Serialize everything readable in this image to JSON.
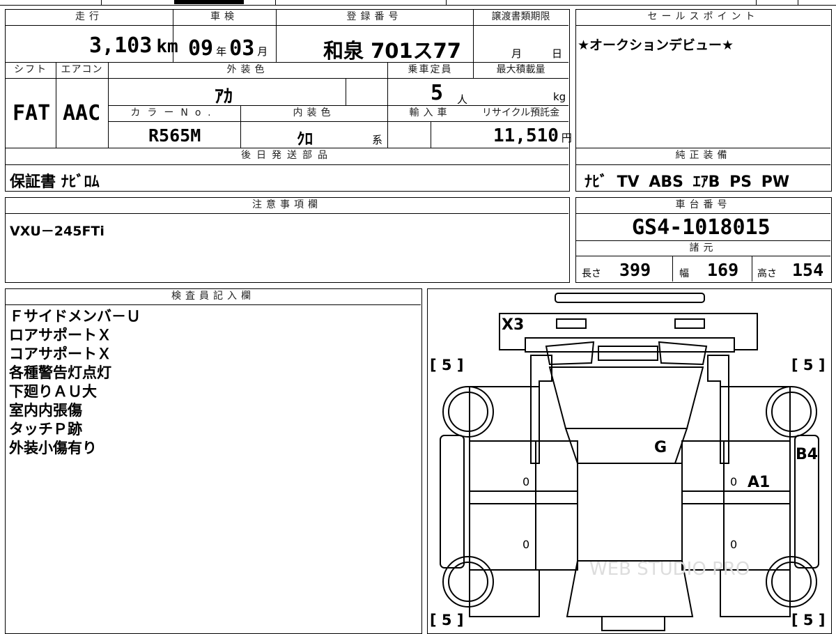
{
  "mileage": {
    "header": "走行",
    "value": "3,103",
    "unit": "km"
  },
  "inspection": {
    "header": "車検",
    "year": "09",
    "year_unit": "年",
    "month": "03",
    "month_unit": "月"
  },
  "registration": {
    "header": "登録番号",
    "value": "和泉 701ス77"
  },
  "transfer_deadline": {
    "header": "譲渡書類期限",
    "month_unit": "月",
    "day_unit": "日"
  },
  "shift": {
    "header": "シフト",
    "value": "FAT"
  },
  "aircon": {
    "header": "エアコン",
    "value": "AAC"
  },
  "exterior_color": {
    "header": "外装色",
    "value": "ｱｶ"
  },
  "capacity": {
    "header": "乗車定員",
    "value": "5",
    "unit": "人"
  },
  "max_load": {
    "header": "最大積載量",
    "unit": "kg"
  },
  "color_no": {
    "header": "カラーNo.",
    "value": "R565M"
  },
  "interior_color": {
    "header": "内装色",
    "value": "ｸﾛ",
    "suffix": "系"
  },
  "import_car": {
    "header": "輸入車"
  },
  "recycle_fee": {
    "header": "リサイクル預託金",
    "value": "11,510",
    "unit": "円"
  },
  "later_shipping": {
    "header": "後日発送部品",
    "value": "保証書 ﾅﾋﾞﾛﾑ"
  },
  "sales_point": {
    "header": "セールスポイント",
    "value": "★オークションデビュー★"
  },
  "genuine_equipment": {
    "header": "純正装備",
    "value": "ﾅﾋﾞ TV ABS ｴｱB PS PW"
  },
  "notes": {
    "header": "注意事項欄",
    "value": "VXU－245FTi"
  },
  "chassis": {
    "header": "車台番号",
    "value": "GS4-1018015"
  },
  "specs": {
    "header": "諸元",
    "length_label": "長さ",
    "length": "399",
    "width_label": "幅",
    "width": "169",
    "height_label": "高さ",
    "height": "154"
  },
  "inspector": {
    "header": "検査員記入欄",
    "lines": [
      "Ｆサイドメンバ－Ｕ",
      "ロアサポートＸ",
      "コアサポートＸ",
      "各種警告灯点灯",
      "下廻りＡＵ大",
      "室内内張傷",
      "タッチＰ跡",
      "外装小傷有り"
    ]
  },
  "diagram": {
    "marks": {
      "front": "X3",
      "glass": "G",
      "right_panel": "B4",
      "right_door": "A1"
    },
    "tread": [
      "[ 5 ]",
      "[ 5 ]",
      "[ 5 ]",
      "[ 5 ]"
    ],
    "door_zero": [
      "0",
      "0",
      "0",
      "0"
    ],
    "watermark": "WEB STUDIO PRO"
  }
}
